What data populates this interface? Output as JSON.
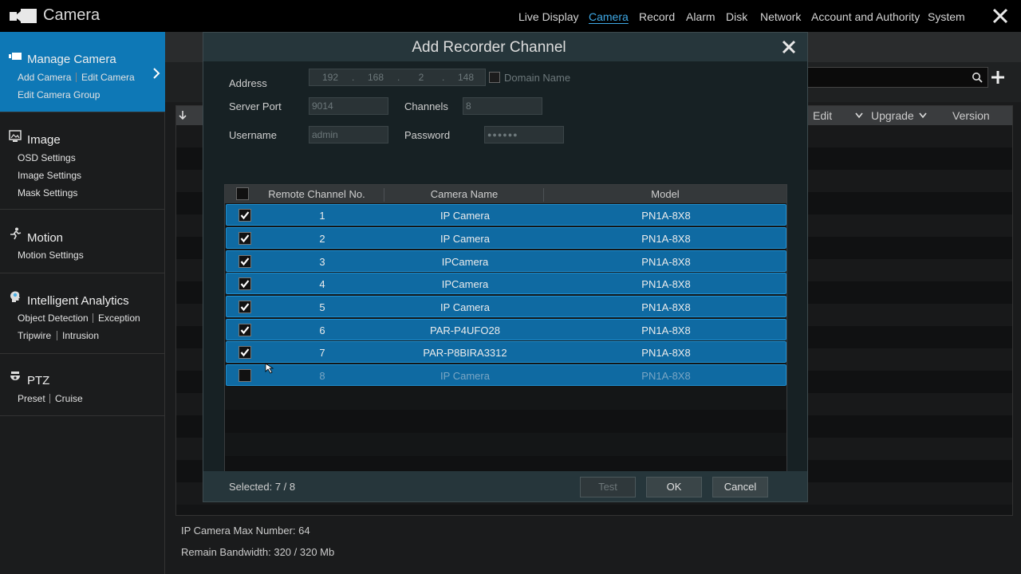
{
  "app": {
    "title": "Camera"
  },
  "nav": {
    "items": [
      {
        "label": "Live Display",
        "active": false
      },
      {
        "label": "Camera",
        "active": true
      },
      {
        "label": "Record",
        "active": false
      },
      {
        "label": "Alarm",
        "active": false
      },
      {
        "label": "Disk",
        "active": false
      },
      {
        "label": "Network",
        "active": false
      },
      {
        "label": "Account and Authority",
        "active": false
      },
      {
        "label": "System",
        "active": false
      }
    ]
  },
  "sidebar": {
    "manage_camera": {
      "title": "Manage Camera",
      "links": [
        "Add Camera",
        "Edit Camera",
        "Edit Camera Group"
      ]
    },
    "image": {
      "title": "Image",
      "links": [
        "OSD Settings",
        "Image Settings",
        "Mask Settings"
      ]
    },
    "motion": {
      "title": "Motion",
      "links": [
        "Motion Settings"
      ]
    },
    "analytics": {
      "title": "Intelligent Analytics",
      "links": [
        "Object Detection",
        "Exception",
        "Tripwire",
        "Intrusion"
      ]
    },
    "ptz": {
      "title": "PTZ",
      "links": [
        "Preset",
        "Cruise"
      ]
    }
  },
  "background_table": {
    "headers": [
      "Edit",
      "Upgrade",
      "Version"
    ]
  },
  "footer": {
    "max_number": "IP Camera Max Number: 64",
    "bandwidth": "Remain Bandwidth: 320 / 320 Mb"
  },
  "dialog": {
    "title": "Add Recorder Channel",
    "address_label": "Address",
    "ip": [
      "192",
      "168",
      "2",
      "148"
    ],
    "domain_label": "Domain Name",
    "server_port_label": "Server Port",
    "server_port": "9014",
    "channels_label": "Channels",
    "channels": "8",
    "username_label": "Username",
    "username": "admin",
    "password_label": "Password",
    "password": "●●●●●●",
    "columns": [
      "Remote Channel No.",
      "Camera Name",
      "Model"
    ],
    "rows": [
      {
        "no": "1",
        "name": "IP Camera",
        "model": "PN1A-8X8",
        "checked": true
      },
      {
        "no": "2",
        "name": "IP Camera",
        "model": "PN1A-8X8",
        "checked": true
      },
      {
        "no": "3",
        "name": "IPCamera",
        "model": "PN1A-8X8",
        "checked": true
      },
      {
        "no": "4",
        "name": "IPCamera",
        "model": "PN1A-8X8",
        "checked": true
      },
      {
        "no": "5",
        "name": "IP Camera",
        "model": "PN1A-8X8",
        "checked": true
      },
      {
        "no": "6",
        "name": "PAR-P4UFO28",
        "model": "PN1A-8X8",
        "checked": true
      },
      {
        "no": "7",
        "name": "PAR-P8BIRA3312",
        "model": "PN1A-8X8",
        "checked": true
      },
      {
        "no": "8",
        "name": "IP Camera",
        "model": "PN1A-8X8",
        "checked": false
      }
    ],
    "selected": "Selected: 7 / 8",
    "buttons": {
      "test": "Test",
      "ok": "OK",
      "cancel": "Cancel"
    }
  },
  "colors": {
    "accent": "#0e78b6",
    "row_selected": "#0f6aa2",
    "nav_active": "#3fa9e6"
  }
}
